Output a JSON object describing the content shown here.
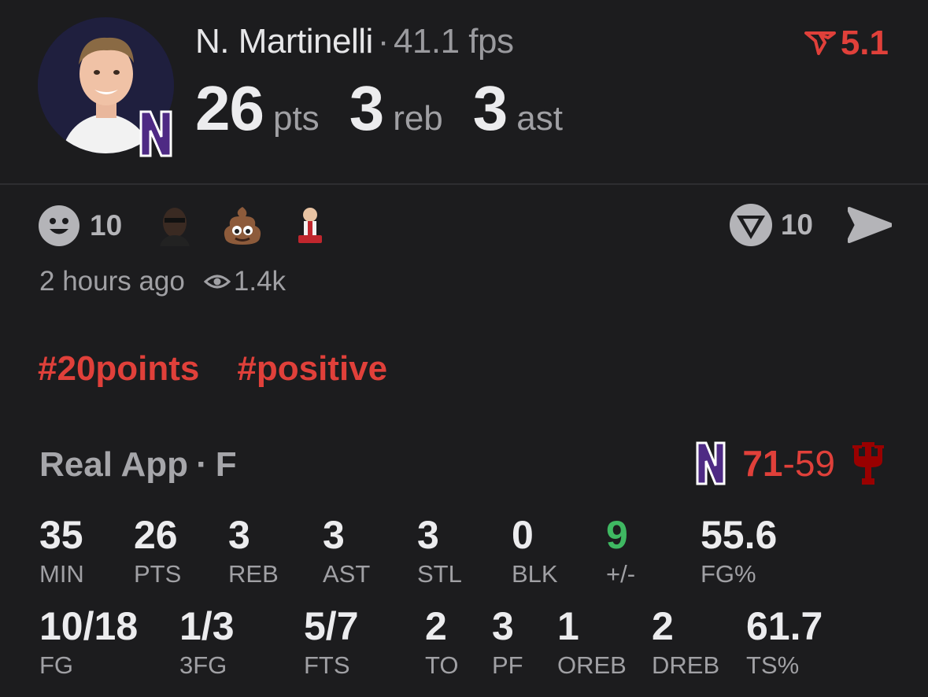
{
  "player": {
    "name": "N. Martinelli",
    "separator": "·",
    "fps": "41.1 fps",
    "team_badge": "N"
  },
  "trend": {
    "icon": "trend-down-icon",
    "value": "5.1",
    "color": "#e0403a"
  },
  "headline": [
    {
      "value": "26",
      "unit": "pts"
    },
    {
      "value": "3",
      "unit": "reb"
    },
    {
      "value": "3",
      "unit": "ast"
    }
  ],
  "reactions": {
    "smiley_count": "10",
    "vote_count": "10"
  },
  "meta": {
    "time": "2 hours ago",
    "views": "1.4k"
  },
  "tags": [
    "#20points",
    "#positive"
  ],
  "game": {
    "source": "Real App",
    "dot": "·",
    "status": "F",
    "own_score": "71",
    "dash": "-",
    "opp_score": "59",
    "own_team_badge": "N"
  },
  "stats_row1": [
    {
      "value": "35",
      "label": "MIN"
    },
    {
      "value": "26",
      "label": "PTS"
    },
    {
      "value": "3",
      "label": "REB"
    },
    {
      "value": "3",
      "label": "AST"
    },
    {
      "value": "3",
      "label": "STL"
    },
    {
      "value": "0",
      "label": "BLK"
    },
    {
      "value": "9",
      "label": "+/-"
    },
    {
      "value": "55.6",
      "label": "FG%"
    }
  ],
  "stats_row2": [
    {
      "value": "10/18",
      "label": "FG"
    },
    {
      "value": "1/3",
      "label": "3FG"
    },
    {
      "value": "5/7",
      "label": "FTS"
    },
    {
      "value": "2",
      "label": "TO"
    },
    {
      "value": "3",
      "label": "PF"
    },
    {
      "value": "1",
      "label": "OREB"
    },
    {
      "value": "2",
      "label": "DREB"
    },
    {
      "value": "61.7",
      "label": "TS%"
    }
  ],
  "colors": {
    "accent_red": "#e0403a",
    "positive_green": "#3fb862",
    "team_purple": "#4e2a84",
    "opponent_red": "#990000"
  }
}
